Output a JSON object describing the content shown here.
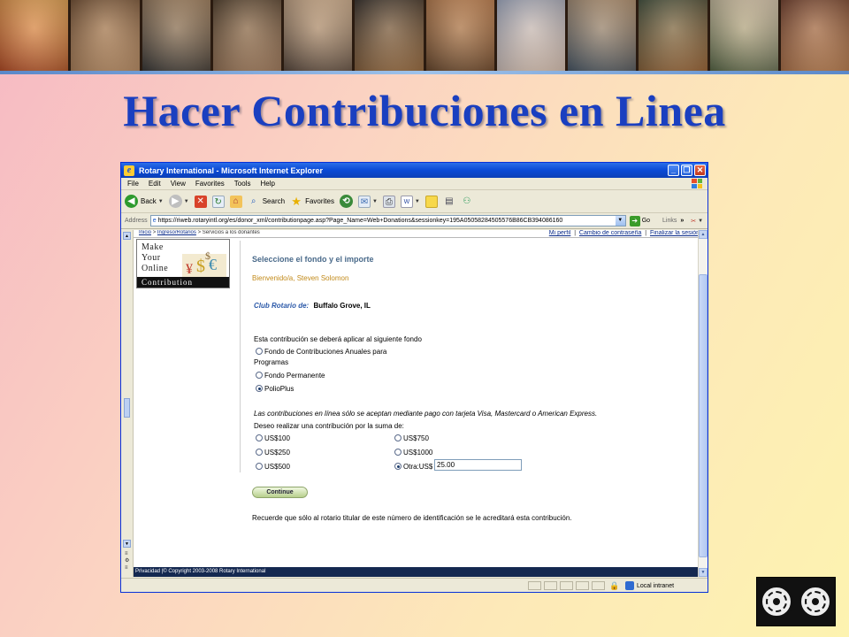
{
  "slide": {
    "title": "Hacer Contribuciones en Linea"
  },
  "banner": {
    "photos": [
      {
        "color_a": "#b8502a",
        "color_b": "#e0a050"
      },
      {
        "color_a": "#6b4a30",
        "color_b": "#c89a70"
      },
      {
        "color_a": "#3a3a3a",
        "color_b": "#a08060"
      },
      {
        "color_a": "#4a3a2a",
        "color_b": "#b08868"
      },
      {
        "color_a": "#5a4a40",
        "color_b": "#d0b090"
      },
      {
        "color_a": "#2e2a28",
        "color_b": "#a8784a"
      },
      {
        "color_a": "#6a4a30",
        "color_b": "#c08050"
      },
      {
        "color_a": "#9aa6c0",
        "color_b": "#e8d0c0"
      },
      {
        "color_a": "#4a5a6a",
        "color_b": "#b09070"
      },
      {
        "color_a": "#3a4a3a",
        "color_b": "#a87040"
      },
      {
        "color_a": "#5a6a4a",
        "color_b": "#d8c8b0"
      },
      {
        "color_a": "#6a3a2a",
        "color_b": "#c88a5a"
      }
    ]
  },
  "browser": {
    "title": "Rotary International - Microsoft Internet Explorer",
    "menu": [
      "File",
      "Edit",
      "View",
      "Favorites",
      "Tools",
      "Help"
    ],
    "toolbar": {
      "back": "Back",
      "search": "Search",
      "favorites": "Favorites"
    },
    "address_label": "Address",
    "url": "https://riweb.rotaryintl.org/es/donor_xml/contributionpage.asp?Page_Name=Web+Donations&sessionkey=195A05058284505576B86CB394086160",
    "go": "Go",
    "links": "Links",
    "status_zone": "Local intranet"
  },
  "page": {
    "breadcrumb": {
      "home": "Inicio",
      "sep": ">",
      "login": "Ingreso/Rotarios",
      "current": "Servicios a los donantes"
    },
    "util_links": {
      "profile": "Mi perfil",
      "password": "Cambio de contraseña",
      "logout": "Finalizar la sesión",
      "sep": "|"
    },
    "logo": {
      "line1": "Make",
      "line2": "Your",
      "line3": "Online",
      "line4": "Contribution"
    },
    "section_title": "Seleccione el fondo y el importe",
    "welcome": "Bienvenido/a, Steven Solomon",
    "club_label": "Club Rotario de:",
    "club_value": "Buffalo Grove, IL",
    "fund_prompt": "Esta contribución se deberá aplicar al siguiente fondo",
    "funds": [
      {
        "label_line1": "Fondo de Contribuciones Anuales para",
        "label_line2": "Programas",
        "selected": false
      },
      {
        "label": "Fondo Permanente",
        "selected": false
      },
      {
        "label": "PolioPlus",
        "selected": true
      }
    ],
    "card_notice": "Las contribuciones en línea sólo se aceptan mediante pago con tarjeta Visa, Mastercard o American Express.",
    "amount_prompt": "Deseo realizar una contribución por la suma de:",
    "amounts_left": [
      {
        "label": "US$100",
        "selected": false
      },
      {
        "label": "US$250",
        "selected": false
      },
      {
        "label": "US$500",
        "selected": false
      }
    ],
    "amounts_right": [
      {
        "label": "US$750",
        "selected": false
      },
      {
        "label": "US$1000",
        "selected": false
      },
      {
        "label": "Otra:US$",
        "selected": true
      }
    ],
    "other_value": "25.00",
    "continue_label": "Continue",
    "notice": "Recuerde que sólo al rotario titular de este número de identificación se le acreditará esta contribución.",
    "footer": "Privacidad |© Copyright 2003-2008 Rotary International"
  }
}
